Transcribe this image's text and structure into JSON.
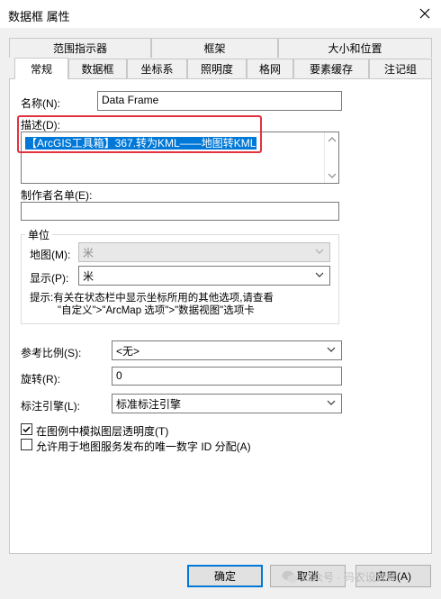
{
  "window": {
    "title": "数据框 属性"
  },
  "tabs_row1": [
    "范围指示器",
    "框架",
    "大小和位置"
  ],
  "tabs_row2": [
    "常规",
    "数据框",
    "坐标系",
    "照明度",
    "格网",
    "要素缓存",
    "注记组"
  ],
  "form": {
    "name_label": "名称(N):",
    "name_value": "Data Frame",
    "desc_label": "描述(D):",
    "desc_value": "【ArcGIS工具箱】367.转为KML——地图转KML",
    "credits_label": "制作者名单(E):",
    "credits_value": ""
  },
  "units": {
    "title": "单位",
    "map_label": "地图(M):",
    "map_value": "米",
    "display_label": "显示(P):",
    "display_value": "米",
    "tip_line1": "提示:有关在状态栏中显示坐标所用的其他选项,请查看",
    "tip_line2": "\"自定义\">\"ArcMap 选项\">\"数据视图\"选项卡"
  },
  "ref_scale": {
    "label": "参考比例(S):",
    "value": "<无>"
  },
  "rotation": {
    "label": "旋转(R):",
    "value": "0"
  },
  "label_engine": {
    "label": "标注引擎(L):",
    "value": "标准标注引擎"
  },
  "checkboxes": [
    {
      "label": "在图例中模拟图层透明度(T)",
      "checked": true
    },
    {
      "label": "允许用于地图服务发布的唯一数字 ID 分配(A)",
      "checked": false
    }
  ],
  "buttons": {
    "ok": "确定",
    "cancel": "取消",
    "apply": "应用(A)"
  },
  "watermark": "公众号 · 码农设计师"
}
